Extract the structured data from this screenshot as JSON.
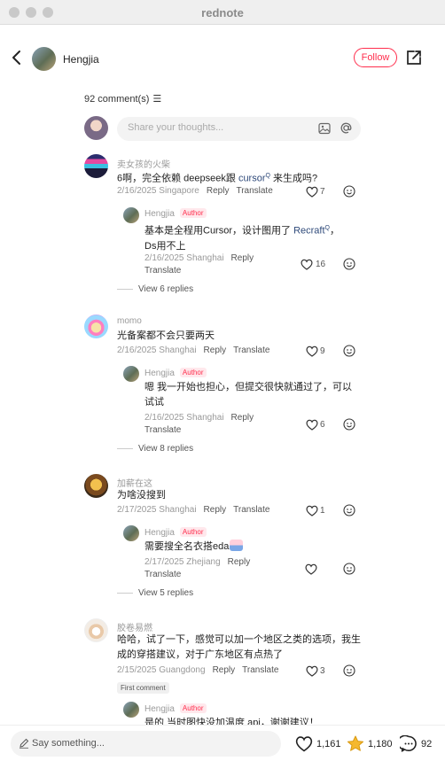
{
  "app": {
    "title": "rednote"
  },
  "header": {
    "author_name": "Hengjia",
    "follow_label": "Follow"
  },
  "comments_header": {
    "count_label": "92 comment(s)",
    "sort_icon": "sort-icon"
  },
  "composer": {
    "placeholder": "Share your thoughts..."
  },
  "comments": [
    {
      "user": "卖女孩的火柴",
      "text_before": "6啊，完全依赖 deepseek跟 ",
      "link": "cursor",
      "text_after": " 来生成吗?",
      "date": "2/16/2025",
      "location": "Singapore",
      "reply_label": "Reply",
      "translate_label": "Translate",
      "likes": "7",
      "reply": {
        "user": "Hengjia",
        "tag": "Author",
        "text_before": "基本是全程用Cursor，设计图用了 ",
        "link": "Recraft",
        "text_after": "，",
        "text_line2": "Ds用不上",
        "date": "2/16/2025",
        "location": "Shanghai",
        "reply_label": "Reply",
        "translate_label": "Translate",
        "likes": "16"
      },
      "view_replies": "View 6 replies"
    },
    {
      "user": "momo",
      "text": "光备案都不会只要两天",
      "date": "2/16/2025",
      "location": "Shanghai",
      "reply_label": "Reply",
      "translate_label": "Translate",
      "likes": "9",
      "reply": {
        "user": "Hengjia",
        "tag": "Author",
        "text_line1": "嗯 我一开始也担心，但提交很快就通过了，可以",
        "text_line2": "试试",
        "date": "2/16/2025",
        "location": "Shanghai",
        "reply_label": "Reply",
        "translate_label": "Translate",
        "likes": "6"
      },
      "view_replies": "View 8 replies"
    },
    {
      "user": "加薪在这",
      "text": "为啥没搜到",
      "date": "2/17/2025",
      "location": "Shanghai",
      "reply_label": "Reply",
      "translate_label": "Translate",
      "likes": "1",
      "reply": {
        "user": "Hengjia",
        "tag": "Author",
        "text_line1": "需要搜全名衣搭eda",
        "date": "2/17/2025",
        "location": "Zhejiang",
        "reply_label": "Reply",
        "translate_label": "Translate",
        "likes": ""
      },
      "view_replies": "View 5 replies"
    },
    {
      "user": "胶卷易燃",
      "text_line1": "哈哈，试了一下，感觉可以加一个地区之类的选项，我生",
      "text_line2": "成的穿搭建议，对于广东地区有点热了",
      "date": "2/15/2025",
      "location": "Guangdong",
      "reply_label": "Reply",
      "translate_label": "Translate",
      "likes": "3",
      "badge": "First comment",
      "reply": {
        "user": "Hengjia",
        "tag": "Author",
        "text_line1": "是的 当时图快没加温度 api，谢谢建议！"
      }
    }
  ],
  "bottom_bar": {
    "placeholder": "Say something...",
    "likes": "1,161",
    "favorites": "1,180",
    "comments": "92",
    "star_color": "#f5b82e"
  }
}
